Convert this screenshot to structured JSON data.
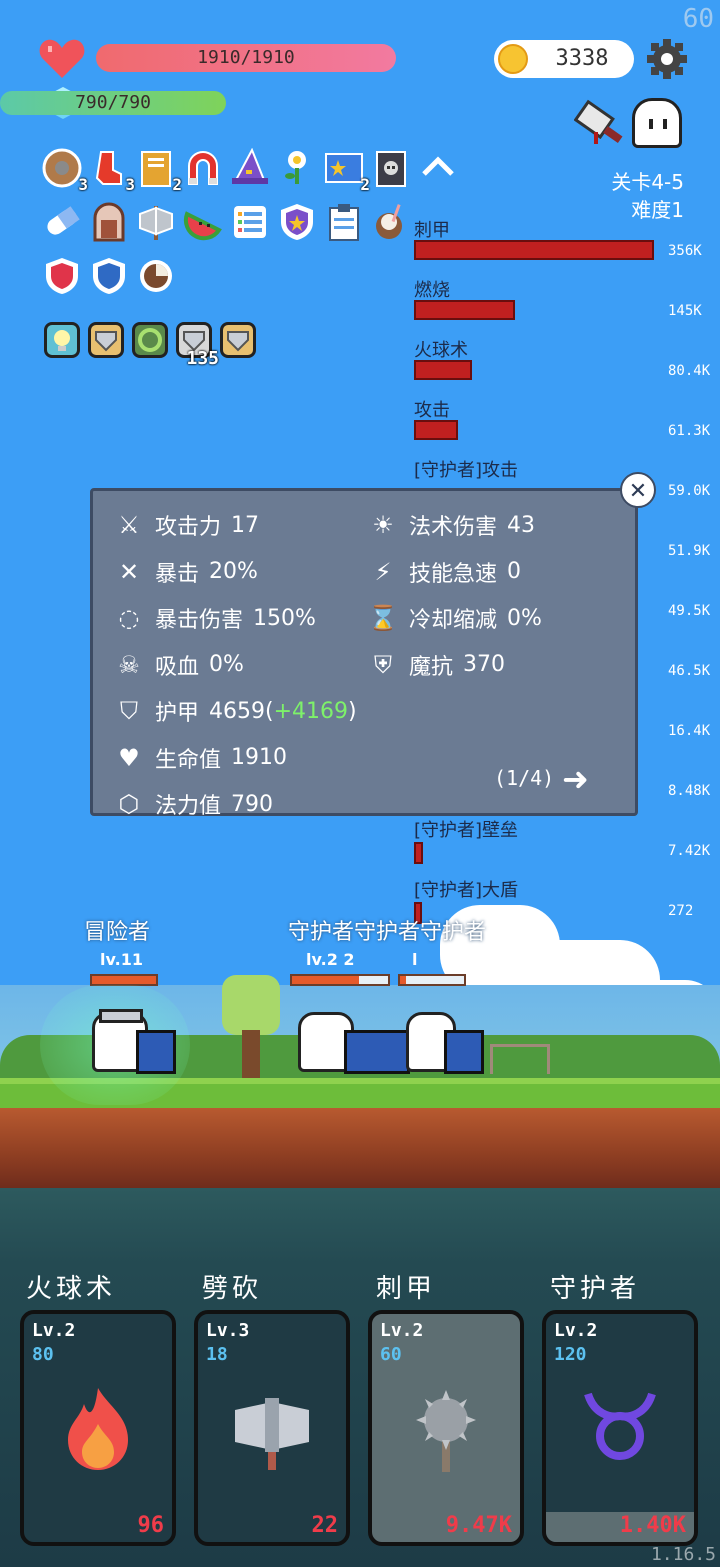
{
  "fps": "60",
  "hud": {
    "hp_text": "1910/1910",
    "mp_text": "790/790",
    "hp_fraction": 1.0,
    "mp_fraction": 1.0,
    "gold": "3338"
  },
  "inventory": {
    "row1": [
      {
        "icon": "round-shield-icon",
        "count": "3"
      },
      {
        "icon": "red-sock-icon",
        "count": "3"
      },
      {
        "icon": "book-icon",
        "count": "2"
      },
      {
        "icon": "magnet-icon",
        "count": ""
      },
      {
        "icon": "wizard-hat-icon",
        "count": ""
      },
      {
        "icon": "flower-icon",
        "count": ""
      },
      {
        "icon": "star-card-icon",
        "count": "2"
      },
      {
        "icon": "skull-book-icon",
        "count": ""
      }
    ],
    "row2": [
      {
        "icon": "pill-icon"
      },
      {
        "icon": "door-icon"
      },
      {
        "icon": "axe-icon"
      },
      {
        "icon": "watermelon-icon"
      },
      {
        "icon": "list-icon"
      },
      {
        "icon": "purple-shield-icon"
      },
      {
        "icon": "clipboard-icon"
      },
      {
        "icon": "coconut-drink-icon"
      }
    ],
    "row3": [
      {
        "icon": "red-shield-icon"
      },
      {
        "icon": "blue-shield-icon"
      },
      {
        "icon": "coconut-icon"
      }
    ],
    "buffs": [
      {
        "icon": "lightbulb-buff-icon",
        "count": ""
      },
      {
        "icon": "armor-buff-icon",
        "count": ""
      },
      {
        "icon": "vine-buff-icon",
        "count": ""
      },
      {
        "icon": "armor-buff-icon",
        "count": "135"
      },
      {
        "icon": "armor-buff-icon",
        "count": ""
      }
    ]
  },
  "level": {
    "stage": "关卡4-5",
    "difficulty": "难度1"
  },
  "damage_list": [
    {
      "name": "刺甲",
      "value": "356K",
      "fraction": 1.0
    },
    {
      "name": "燃烧",
      "value": "145K",
      "fraction": 0.41
    },
    {
      "name": "火球术",
      "value": "80.4K",
      "fraction": 0.23
    },
    {
      "name": "攻击",
      "value": "61.3K",
      "fraction": 0.17
    },
    {
      "name": "[守护者]攻击",
      "value": "59.0K",
      "fraction": 0.17
    },
    {
      "name": "",
      "value": "51.9K",
      "fraction": 0.15
    },
    {
      "name": "",
      "value": "49.5K",
      "fraction": 0.14
    },
    {
      "name": "",
      "value": "46.5K",
      "fraction": 0.13
    },
    {
      "name": "",
      "value": "16.4K",
      "fraction": 0.05
    },
    {
      "name": "",
      "value": "8.48K",
      "fraction": 0.024
    },
    {
      "name": "[守护者]壁垒",
      "value": "7.42K",
      "fraction": 0.021
    },
    {
      "name": "[守护者]大盾",
      "value": "272",
      "fraction": 0.002
    }
  ],
  "stats_panel": {
    "left": [
      {
        "icon": "attack-icon",
        "label": "攻击力",
        "value": "17"
      },
      {
        "icon": "crit-icon",
        "label": "暴击",
        "value": "20%"
      },
      {
        "icon": "crit-damage-icon",
        "label": "暴击伤害",
        "value": "150%"
      },
      {
        "icon": "lifesteal-icon",
        "label": "吸血",
        "value": "0%"
      },
      {
        "icon": "armor-icon",
        "label": "护甲",
        "value": "4659",
        "bonus": "+4169"
      },
      {
        "icon": "heart-icon",
        "label": "生命值",
        "value": "1910"
      },
      {
        "icon": "mana-icon",
        "label": "法力值",
        "value": "790"
      }
    ],
    "right": [
      {
        "icon": "spell-power-icon",
        "label": "法术伤害",
        "value": "43"
      },
      {
        "icon": "haste-icon",
        "label": "技能急速",
        "value": "0"
      },
      {
        "icon": "hourglass-icon",
        "label": "冷却缩减",
        "value": "0%"
      },
      {
        "icon": "magic-resist-icon",
        "label": "魔抗",
        "value": "370"
      }
    ],
    "page": "(1/4)",
    "bonus_color": "#7ef16a"
  },
  "battle": {
    "player_name": "冒险者",
    "player_level": "lv.11",
    "enemy_names": "守护者守护者守护者",
    "enemy_level": "lv.2  2",
    "enemy_level_b": "l"
  },
  "skills": [
    {
      "title": "火球术",
      "lv": "Lv.2",
      "cost": "80",
      "icon": "fire-icon",
      "value": "96"
    },
    {
      "title": "劈砍",
      "lv": "Lv.3",
      "cost": "18",
      "icon": "double-axe-icon",
      "value": "22"
    },
    {
      "title": "刺甲",
      "lv": "Lv.2",
      "cost": "60",
      "icon": "spiked-mace-icon",
      "value": "9.47K"
    },
    {
      "title": "守护者",
      "lv": "Lv.2",
      "cost": "120",
      "icon": "taurus-icon",
      "value": "1.40K"
    }
  ],
  "version": "1.16.5"
}
